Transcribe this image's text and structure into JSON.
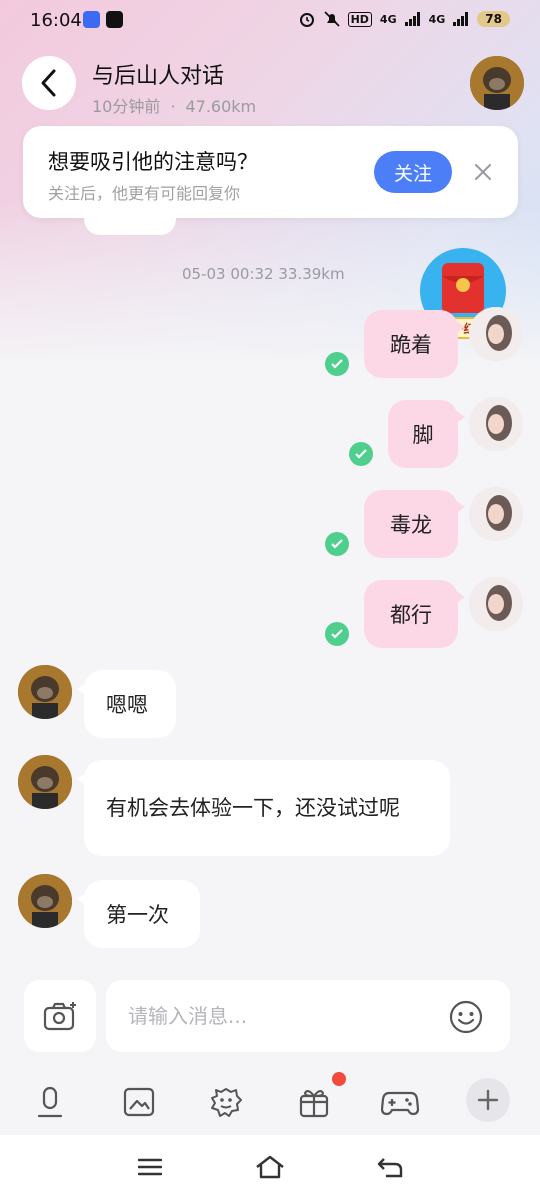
{
  "status": {
    "time": "16:04",
    "hd_label": "HD",
    "net1": "4G",
    "net2": "4G",
    "battery": "78"
  },
  "header": {
    "title": "与后山人对话",
    "time_ago": "10分钟前",
    "separator": "·",
    "distance": "47.60km"
  },
  "follow_prompt": {
    "title": "想要吸引他的注意吗？",
    "subtitle": "关注后，他更有可能回复你",
    "button": "关注"
  },
  "chat": {
    "timestamp": "05-03 00:32  33.39km",
    "red_packet_label": "五一红包",
    "sent": [
      {
        "text": "跪着"
      },
      {
        "text": "脚"
      },
      {
        "text": "毒龙"
      },
      {
        "text": "都行"
      }
    ],
    "received": [
      {
        "text": "嗯嗯"
      },
      {
        "text": "有机会去体验一下，还没试过呢"
      },
      {
        "text": "第一次"
      }
    ]
  },
  "composer": {
    "placeholder": "请输入消息..."
  },
  "icons": {
    "back": "chevron-left-icon",
    "close": "close-icon",
    "check": "check-icon",
    "camera": "camera-icon",
    "emoji": "smiley-icon",
    "mic": "mic-icon",
    "image": "image-icon",
    "sticker": "sticker-icon",
    "gift": "gift-icon",
    "game": "gamepad-icon",
    "plus": "plus-icon"
  },
  "colors": {
    "accent": "#4c7ef7",
    "sent_bubble": "#fcd7e6",
    "read_check": "#4fcf8e",
    "notify_dot": "#f24a3d"
  }
}
